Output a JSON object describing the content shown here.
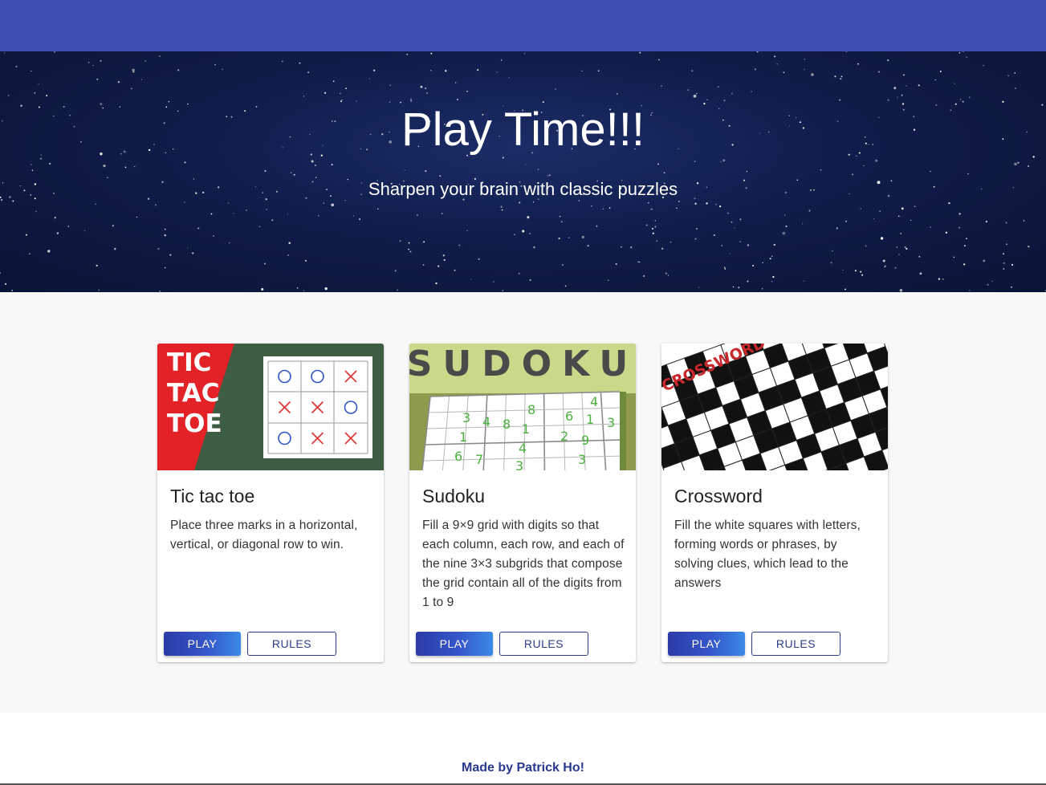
{
  "header": {
    "bar_color": "#3f51b5"
  },
  "hero": {
    "title": "Play Time!!!",
    "subtitle": "Sharpen your brain with classic puzzles"
  },
  "cards": [
    {
      "title": "Tic tac toe",
      "description": "Place three marks in a horizontal, vertical, or diagonal row to win.",
      "play_label": "PLAY",
      "rules_label": "RULES",
      "image_text": [
        "TIC",
        "TAC",
        "TOE"
      ],
      "board": [
        "O",
        "O",
        "X",
        "X",
        "X",
        "O",
        "O",
        "X",
        "X"
      ]
    },
    {
      "title": "Sudoku",
      "description": "Fill a 9×9 grid with digits so that each column, each row, and each of the nine 3×3 subgrids that compose the grid contain all of the digits from 1 to 9",
      "play_label": "PLAY",
      "rules_label": "RULES",
      "image_text": "SUDOKU"
    },
    {
      "title": "Crossword",
      "description": "Fill the white squares with letters, forming words or phrases, by solving clues, which lead to the answers",
      "play_label": "PLAY",
      "rules_label": "RULES",
      "image_text": "CROSSWORD"
    }
  ],
  "footer": {
    "text": "Made by Patrick Ho!"
  },
  "colors": {
    "accent": "#3f51b5",
    "button_gradient_start": "#2b3ba8",
    "button_gradient_end": "#3a8ae6",
    "footer_text": "#2a3990"
  }
}
